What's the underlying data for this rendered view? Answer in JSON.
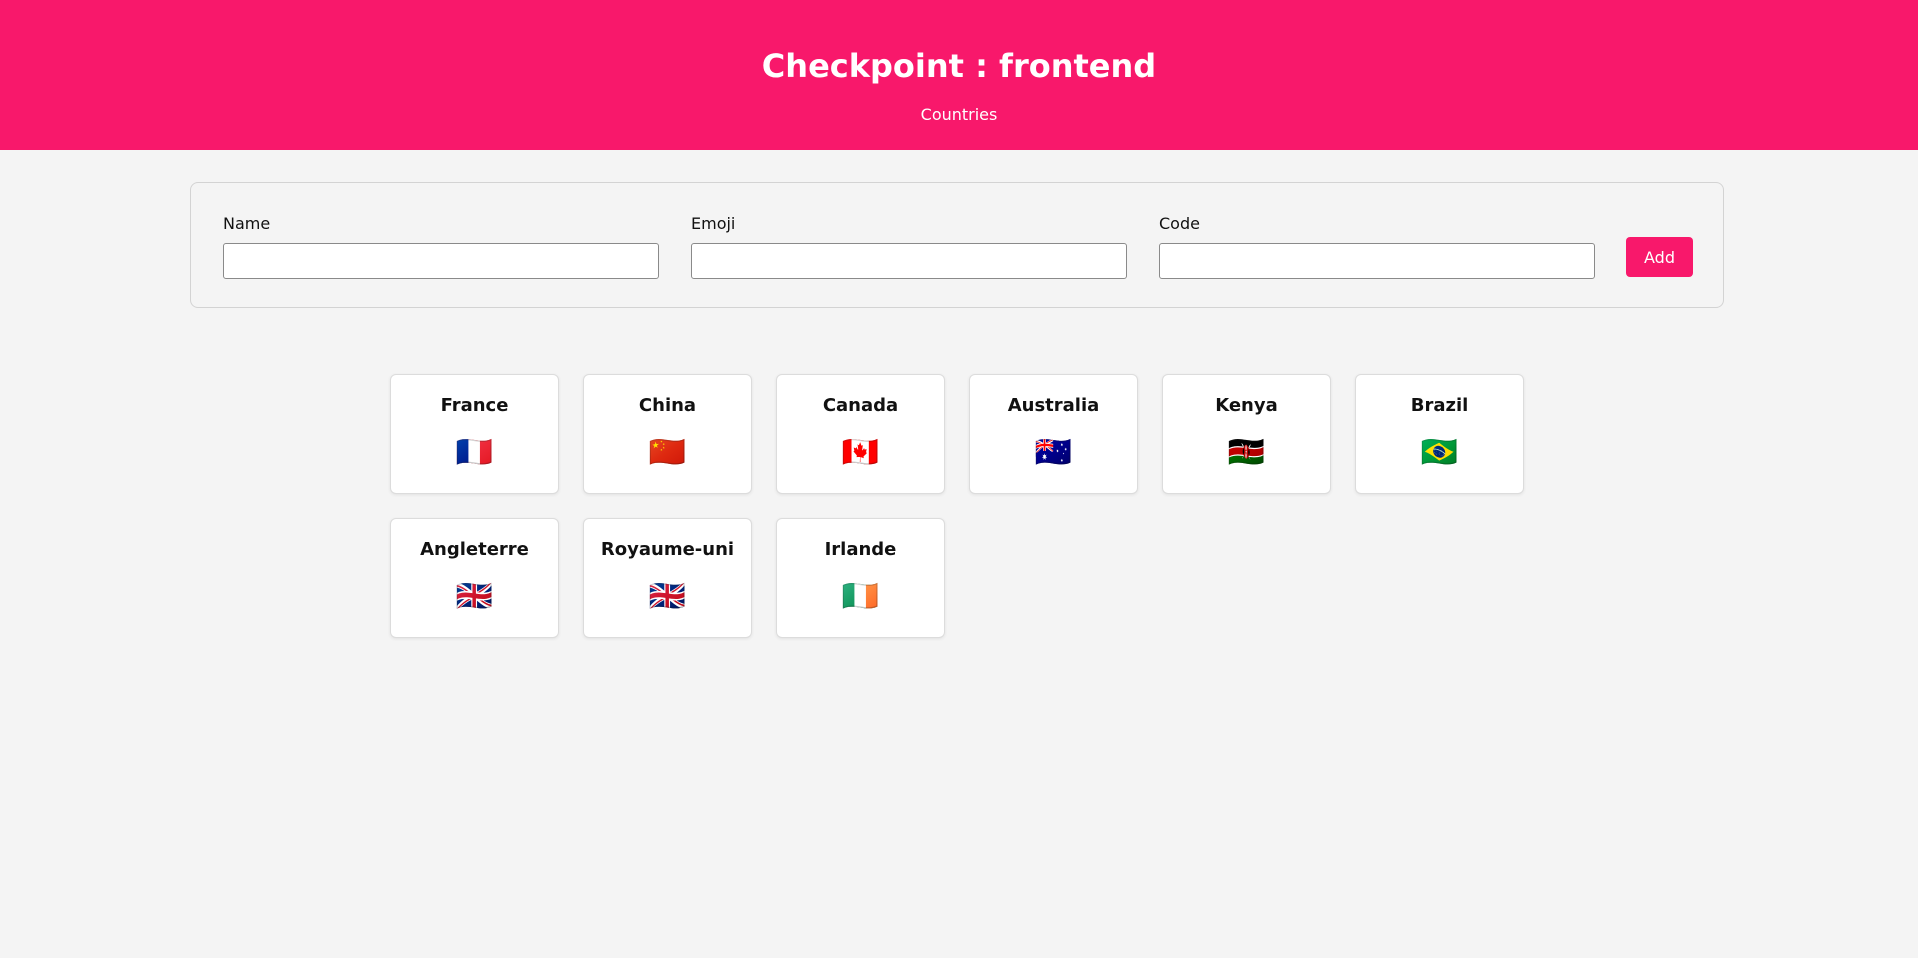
{
  "header": {
    "title": "Checkpoint : frontend",
    "subtitle": "Countries"
  },
  "form": {
    "name_label": "Name",
    "name_value": "",
    "emoji_label": "Emoji",
    "emoji_value": "",
    "code_label": "Code",
    "code_value": "",
    "add_label": "Add"
  },
  "colors": {
    "accent": "#f8186b",
    "background": "#f4f4f4"
  },
  "countries": [
    {
      "name": "France",
      "emoji": "🇫🇷"
    },
    {
      "name": "China",
      "emoji": "🇨🇳"
    },
    {
      "name": "Canada",
      "emoji": "🇨🇦"
    },
    {
      "name": "Australia",
      "emoji": "🇦🇺"
    },
    {
      "name": "Kenya",
      "emoji": "🇰🇪"
    },
    {
      "name": "Brazil",
      "emoji": "🇧🇷"
    },
    {
      "name": "Angleterre",
      "emoji": "🇬🇧"
    },
    {
      "name": "Royaume-uni",
      "emoji": "🇬🇧"
    },
    {
      "name": "Irlande",
      "emoji": "🇮🇪"
    }
  ]
}
